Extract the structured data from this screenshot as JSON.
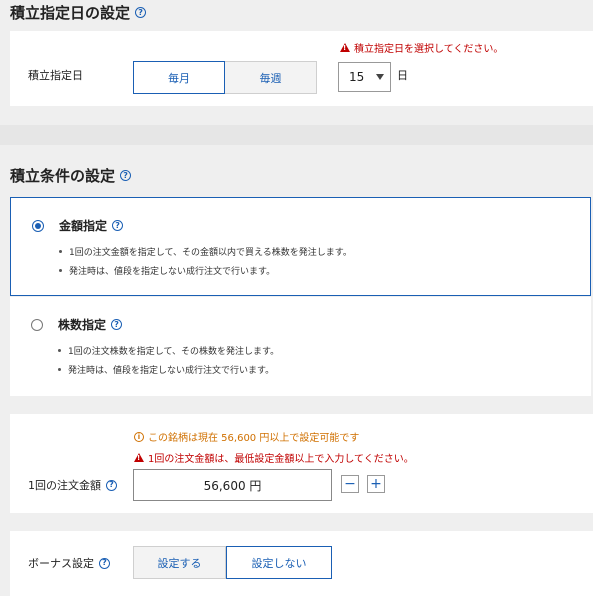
{
  "section1": {
    "title": "積立指定日の設定",
    "label": "積立指定日",
    "error": "積立指定日を選択してください。",
    "frequency": [
      {
        "label": "毎月",
        "active": true
      },
      {
        "label": "毎週",
        "active": false
      }
    ],
    "day_value": "15",
    "day_unit": "日"
  },
  "section2": {
    "title": "積立条件の設定",
    "options": [
      {
        "title": "金額指定",
        "selected": true,
        "bullets": [
          "1回の注文金額を指定して、その金額以内で買える株数を発注します。",
          "発注時は、値段を指定しない成行注文で行います。"
        ]
      },
      {
        "title": "株数指定",
        "selected": false,
        "bullets": [
          "1回の注文株数を指定して、その株数を発注します。",
          "発注時は、値段を指定しない成行注文で行います。"
        ]
      }
    ]
  },
  "amount": {
    "info": "この銘柄は現在 56,600 円以上で設定可能です",
    "error": "1回の注文金額は、最低設定金額以上で入力してください。",
    "label": "1回の注文金額",
    "value": "56,600 円",
    "minus": "−",
    "plus": "+"
  },
  "bonus": {
    "label": "ボーナス設定",
    "options": [
      {
        "label": "設定する",
        "active": false
      },
      {
        "label": "設定しない",
        "active": true
      }
    ]
  },
  "colors": {
    "accent": "#1a5fb4",
    "error": "#c00000",
    "info": "#d07000"
  }
}
